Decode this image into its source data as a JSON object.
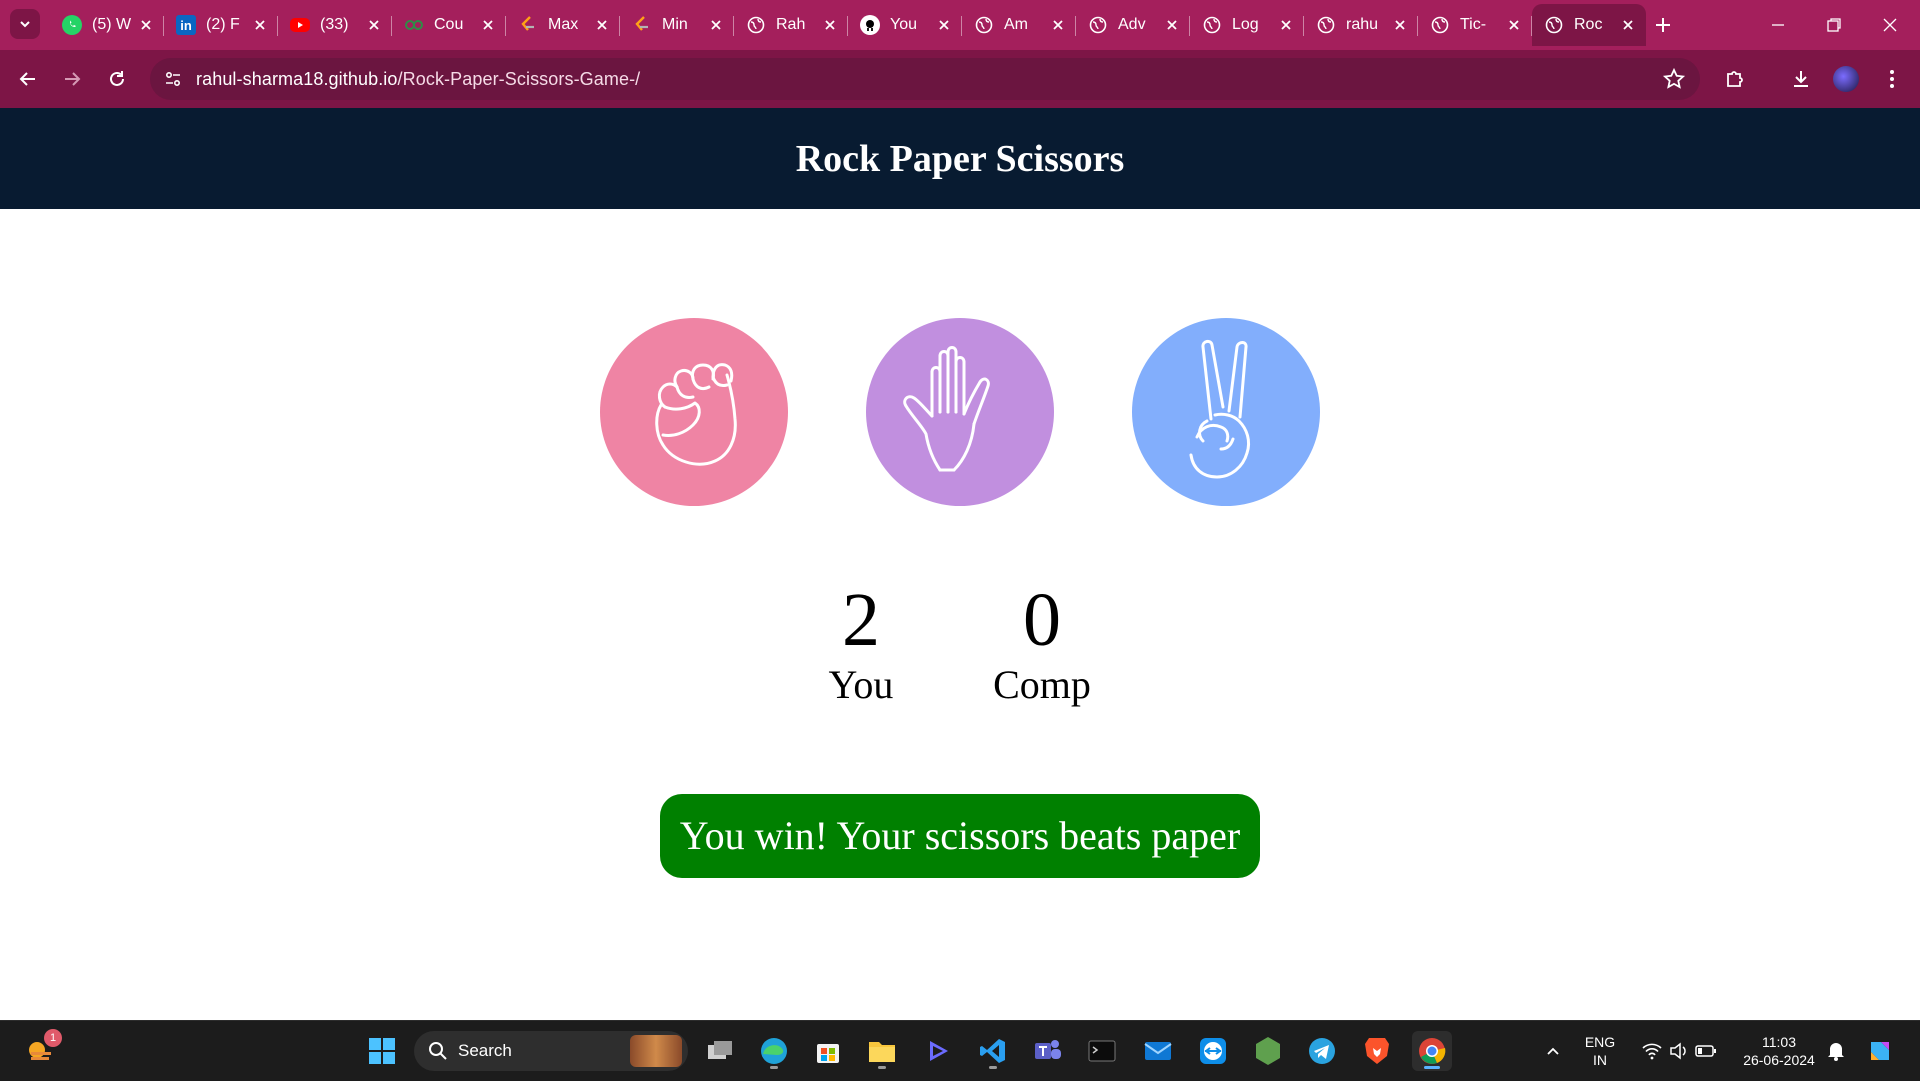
{
  "browser": {
    "tabs": [
      {
        "label": "(5) W",
        "icon": "whatsapp-icon",
        "color": "#25d366"
      },
      {
        "label": "(2) F",
        "icon": "linkedin-icon",
        "color": "#0a66c2"
      },
      {
        "label": "(33)",
        "icon": "youtube-icon",
        "color": "#ff0000"
      },
      {
        "label": "Cou",
        "icon": "geeksforgeeks-icon",
        "color": "#2f8d46"
      },
      {
        "label": "Max",
        "icon": "leetcode-icon",
        "color": "#ffa116"
      },
      {
        "label": "Min",
        "icon": "leetcode-icon",
        "color": "#ffa116"
      },
      {
        "label": "Rah",
        "icon": "globe-icon",
        "color": "#ffffff"
      },
      {
        "label": "You",
        "icon": "github-icon",
        "color": "#ffffff"
      },
      {
        "label": "Am",
        "icon": "globe-icon",
        "color": "#ffffff"
      },
      {
        "label": "Adv",
        "icon": "globe-icon",
        "color": "#ffffff"
      },
      {
        "label": "Log",
        "icon": "globe-icon",
        "color": "#ffffff"
      },
      {
        "label": "rahu",
        "icon": "globe-icon",
        "color": "#ffffff"
      },
      {
        "label": "Tic-",
        "icon": "globe-icon",
        "color": "#ffffff"
      },
      {
        "label": "Roc",
        "icon": "globe-icon",
        "color": "#ffffff",
        "active": true
      }
    ],
    "url_host": "rahul-sharma18.github.io",
    "url_path": "/Rock-Paper-Scissors-Game-/",
    "theme": {
      "tabstrip": "#a41f5c",
      "toolbar": "#7d1546"
    }
  },
  "page": {
    "title": "Rock Paper Scissors",
    "choices": [
      {
        "id": "rock",
        "icon": "rock-fist-icon",
        "color": "#ef84a4"
      },
      {
        "id": "paper",
        "icon": "paper-hand-icon",
        "color": "#c18fdf"
      },
      {
        "id": "scissors",
        "icon": "scissors-hand-icon",
        "color": "#82aefc"
      }
    ],
    "score": {
      "user_score": "2",
      "user_label": "You",
      "comp_score": "0",
      "comp_label": "Comp"
    },
    "message": "You win! Your scissors beats paper",
    "message_color": "#008000",
    "header_color": "#081b31"
  },
  "taskbar": {
    "search_label": "Search",
    "weather_badge": "1",
    "lang_line1": "ENG",
    "lang_line2": "IN",
    "time": "11:03",
    "date": "26-06-2024"
  }
}
